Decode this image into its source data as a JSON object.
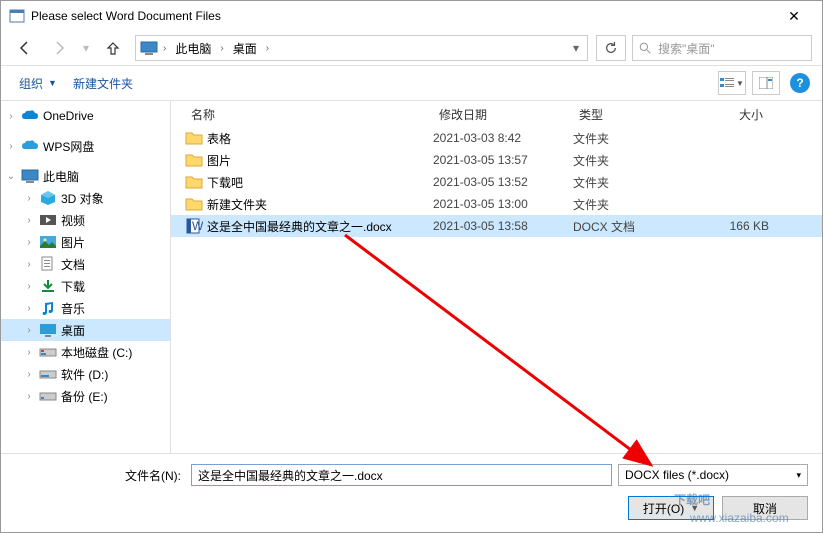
{
  "window": {
    "title": "Please select Word Document Files"
  },
  "breadcrumb": {
    "loc1": "此电脑",
    "loc2": "桌面"
  },
  "search": {
    "placeholder": "搜索\"桌面\""
  },
  "toolbar": {
    "organize": "组织",
    "newfolder": "新建文件夹"
  },
  "columns": {
    "name": "名称",
    "date": "修改日期",
    "type": "类型",
    "size": "大小"
  },
  "sidebar": {
    "onedrive": "OneDrive",
    "wps": "WPS网盘",
    "thispc": "此电脑",
    "objects3d": "3D 对象",
    "videos": "视频",
    "pictures": "图片",
    "documents": "文档",
    "downloads": "下载",
    "music": "音乐",
    "desktop": "桌面",
    "diskc": "本地磁盘 (C:)",
    "diskd": "软件 (D:)",
    "diske": "备份 (E:)"
  },
  "files": [
    {
      "name": "表格",
      "date": "2021-03-03 8:42",
      "type": "文件夹",
      "size": ""
    },
    {
      "name": "图片",
      "date": "2021-03-05 13:57",
      "type": "文件夹",
      "size": ""
    },
    {
      "name": "下载吧",
      "date": "2021-03-05 13:52",
      "type": "文件夹",
      "size": ""
    },
    {
      "name": "新建文件夹",
      "date": "2021-03-05 13:00",
      "type": "文件夹",
      "size": ""
    },
    {
      "name": "这是全中国最经典的文章之一.docx",
      "date": "2021-03-05 13:58",
      "type": "DOCX 文档",
      "size": "166 KB",
      "selected": true,
      "doc": true
    }
  ],
  "bottom": {
    "fnlabel": "文件名(N):",
    "filename": "这是全中国最经典的文章之一.docx",
    "filter": "DOCX files (*.docx)",
    "open": "打开(O)",
    "cancel": "取消"
  },
  "watermark": "下载吧",
  "watermark_url": "www.xiazaiba.com"
}
